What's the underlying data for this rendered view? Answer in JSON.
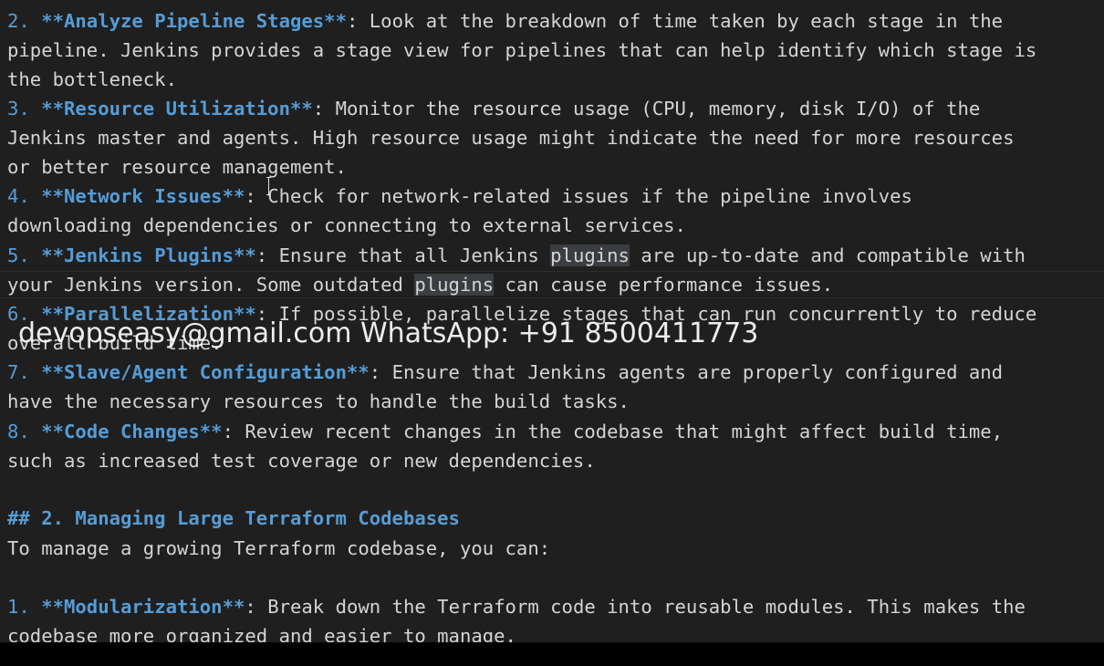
{
  "lines": {
    "l0": "        ",
    "l1": {
      "num": "2. ",
      "key": "**Analyze Pipeline Stages**",
      "text": ": Look at the breakdown of time taken by each stage in the"
    },
    "l2": "pipeline. Jenkins provides a stage view for pipelines that can help identify which stage is",
    "l3": "the bottleneck.",
    "l4": {
      "num": "3. ",
      "key": "**Resource Utilization**",
      "text": ": Monitor the resource usage (CPU, memory, disk I/O) of the"
    },
    "l5": "Jenkins master and agents. High resource usage might indicate the need for more resources",
    "l6": "or better resource management.",
    "l7": {
      "num": "4. ",
      "key": "**Network Issues**",
      "text": ": Check for network-related issues if the pipeline involves"
    },
    "l8": "downloading dependencies or connecting to external services.",
    "l9": {
      "num": "5. ",
      "key": "**Jenkins Plugins**",
      "text_a": ": Ensure that all Jenkins ",
      "hl": "plugins",
      "text_b": " are up-to-date and compatible with"
    },
    "l10": {
      "text_a": "your Jenkins version. Some outdated ",
      "hl": "plugins",
      "text_b": " can cause performance issues."
    },
    "l11": {
      "num": "6. ",
      "key": "**Parallelization**",
      "text": ": If possible, parallelize stages that can run concurrently to reduce"
    },
    "l12": "overall build time.",
    "l13": {
      "num": "7. ",
      "key": "**Slave/Agent Configuration**",
      "text": ": Ensure that Jenkins agents are properly configured and"
    },
    "l14": "have the necessary resources to handle the build tasks.",
    "l15": {
      "num": "8. ",
      "key": "**Code Changes**",
      "text": ": Review recent changes in the codebase that might affect build time,"
    },
    "l16": "such as increased test coverage or new dependencies.",
    "l17": "## 2. Managing Large Terraform Codebases",
    "l18": "To manage a growing Terraform codebase, you can:",
    "l19": {
      "num": "1. ",
      "key": "**Modularization**",
      "text": ": Break down the Terraform code into reusable modules. This makes the"
    },
    "l20": "codebase more organized and easier to manage."
  },
  "watermark": "devopseasy@gmail.com WhatsApp: +91 8500411773",
  "colors": {
    "background": "#1f1f1f",
    "text": "#d4d4d4",
    "markdown_accent": "#569cd6",
    "selection_highlight": "#3a3d41"
  },
  "icons": {
    "cursor": "text-cursor-ibeam-icon"
  }
}
